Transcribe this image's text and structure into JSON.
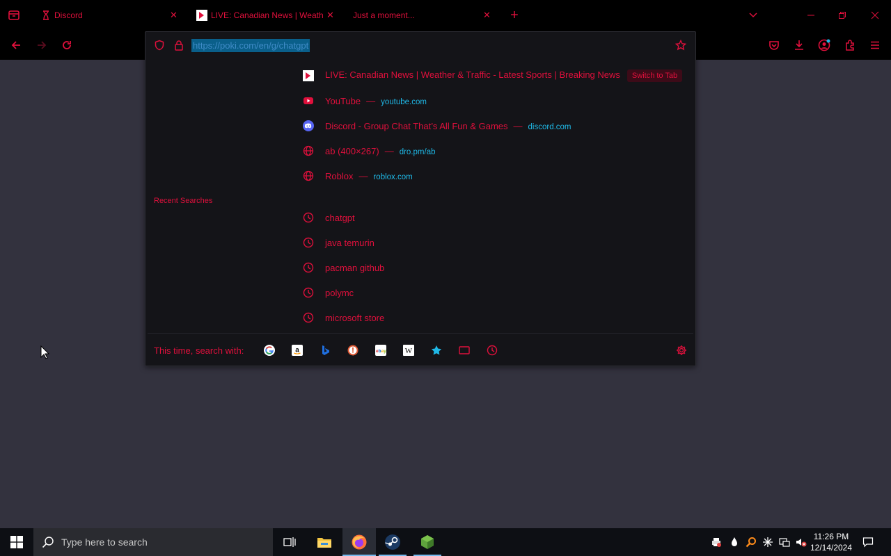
{
  "tabs": [
    {
      "title": "Discord",
      "active": false
    },
    {
      "title": "LIVE: Canadian News | Weather & Traffic - Latest Sports | Breaking News",
      "active": true
    },
    {
      "title": "Just a moment...",
      "active": false
    }
  ],
  "urlbar": {
    "value": "https://poki.com/en/g/chatgpt"
  },
  "suggestions": [
    {
      "icon": "ctv-favicon",
      "title": "LIVE: Canadian News | Weather & Traffic - Latest Sports | Breaking News",
      "action": "Switch to Tab"
    },
    {
      "icon": "youtube-favicon",
      "title": "YouTube",
      "sep": "—",
      "url": "youtube.com"
    },
    {
      "icon": "discord-favicon",
      "title": "Discord - Group Chat That’s All Fun & Games",
      "sep": "—",
      "url": "discord.com"
    },
    {
      "icon": "globe-icon",
      "title": "ab (400×267)",
      "sep": "—",
      "url": "dro.pm/ab"
    },
    {
      "icon": "globe-icon",
      "title": "Roblox",
      "sep": "—",
      "url": "roblox.com"
    }
  ],
  "recent_label": "Recent Searches",
  "recent": [
    "chatgpt",
    "java temurin",
    "pacman github",
    "polymc",
    "microsoft store"
  ],
  "search_with_label": "This time, search with:",
  "engines": [
    "google",
    "amazon",
    "bing",
    "duckduckgo",
    "ebay",
    "wikipedia",
    "bookmarks",
    "tabs",
    "history"
  ],
  "taskbar": {
    "search_placeholder": "Type here to search",
    "time": "11:26 PM",
    "date": "12/14/2024"
  },
  "colors": {
    "accent": "#e0103c",
    "url": "#1fb8e6",
    "background": "#33323e"
  }
}
